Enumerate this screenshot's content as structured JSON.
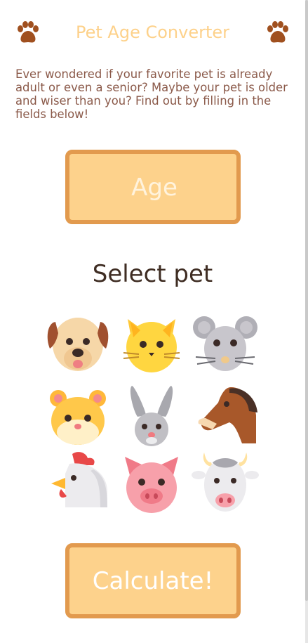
{
  "header": {
    "title": "Pet Age Converter",
    "icon": "paw-icon"
  },
  "intro": "Ever wondered if your favorite pet is already adult or even a senior? Maybe your pet is older and wiser than you? Find out by filling in the fields below!",
  "age_input": {
    "placeholder": "Age",
    "value": ""
  },
  "select_heading": "Select pet",
  "pets": [
    "dog-icon",
    "cat-icon",
    "mouse-icon",
    "hamster-icon",
    "rabbit-icon",
    "horse-icon",
    "chicken-icon",
    "pig-icon",
    "cow-icon"
  ],
  "calculate_label": "Calculate!",
  "colors": {
    "accent": "#fdd28c",
    "border": "#e29a4e",
    "title": "#fdd18a",
    "text": "#8b5a4a",
    "paw": "#a0501f"
  }
}
